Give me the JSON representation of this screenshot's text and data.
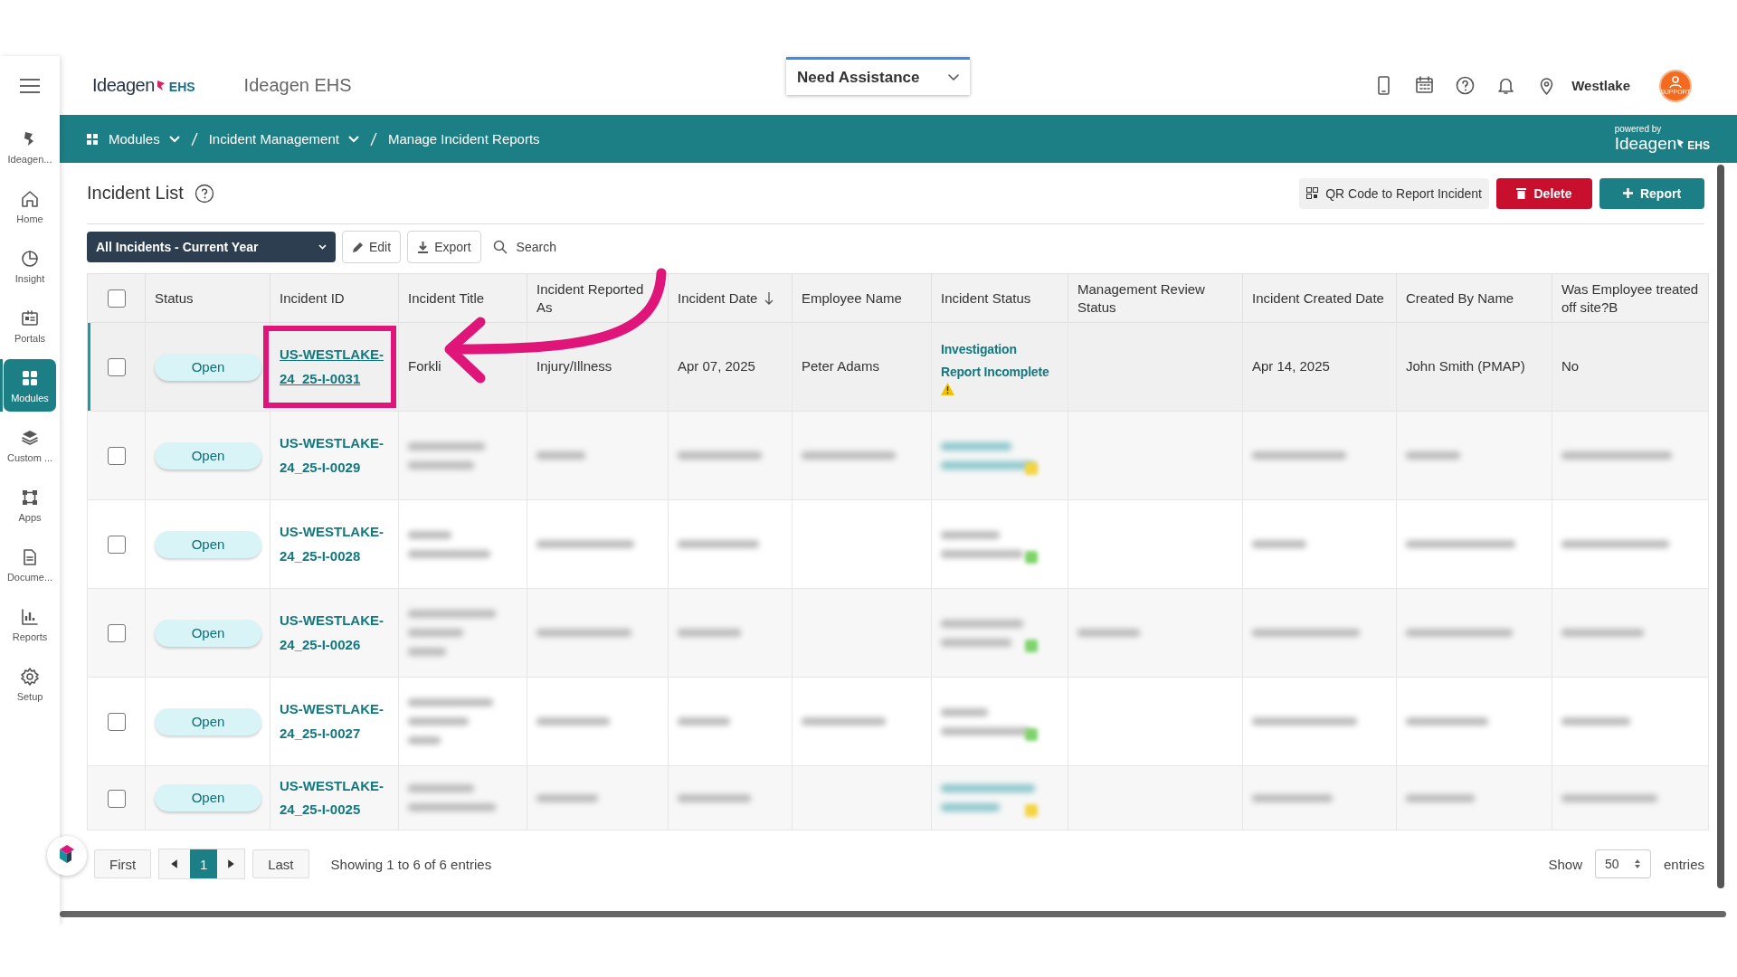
{
  "header": {
    "logo_text": "Ideagen",
    "logo_suffix": "EHS",
    "app_title": "Ideagen EHS",
    "assist": "Need Assistance",
    "location": "Westlake",
    "avatar_text": "SUPPORT"
  },
  "sidebar": {
    "items": [
      {
        "label": "Ideagen...",
        "selected": false
      },
      {
        "label": "Home",
        "selected": false
      },
      {
        "label": "Insight",
        "selected": false
      },
      {
        "label": "Portals",
        "selected": false
      },
      {
        "label": "Modules",
        "selected": true
      },
      {
        "label": "Custom ...",
        "selected": false
      },
      {
        "label": "Apps",
        "selected": false
      },
      {
        "label": "Docume...",
        "selected": false
      },
      {
        "label": "Reports",
        "selected": false
      },
      {
        "label": "Setup",
        "selected": false
      }
    ]
  },
  "breadcrumb": [
    {
      "label": "Modules",
      "dropdown": true
    },
    {
      "label": "Incident Management",
      "dropdown": true
    },
    {
      "label": "Manage Incident Reports",
      "dropdown": false
    }
  ],
  "powered_by": {
    "caption": "powered by",
    "brand": "Ideagen",
    "suffix": "EHS"
  },
  "page_title": "Incident List",
  "actions": [
    {
      "label": "QR Code to Report Incident",
      "kind": "qr"
    },
    {
      "label": "Delete",
      "kind": "delete"
    },
    {
      "label": "Report",
      "kind": "report"
    }
  ],
  "toolbar": {
    "filter": "All Incidents - Current Year",
    "buttons": [
      {
        "label": "Edit",
        "kind": "edit"
      },
      {
        "label": "Export",
        "kind": "export"
      }
    ],
    "search": {
      "placeholder": "Search"
    }
  },
  "table": {
    "select_all_checked": false,
    "columns": [
      {
        "label": "Status",
        "sorted": false
      },
      {
        "label": "Incident ID",
        "sorted": false
      },
      {
        "label": "Incident Title",
        "sorted": false
      },
      {
        "label": "Incident Reported As",
        "sorted": false
      },
      {
        "label": "Incident Date",
        "sorted": true
      },
      {
        "label": "Employee Name",
        "sorted": false
      },
      {
        "label": "Incident Status",
        "sorted": false
      },
      {
        "label": "Management Review Status",
        "sorted": false
      },
      {
        "label": "Incident Created Date",
        "sorted": false
      },
      {
        "label": "Created By Name",
        "sorted": false
      },
      {
        "label": "Was Employee treated off site?B",
        "sorted": false
      }
    ],
    "rows": [
      {
        "selected": true,
        "checked": false,
        "cells": [
          {
            "kind": "badge",
            "text": "Open"
          },
          {
            "kind": "link",
            "text": "US-WESTLAKE-24_25-I-0031",
            "underlined": true,
            "highlighted": true
          },
          {
            "kind": "text",
            "text": "Forkli"
          },
          {
            "kind": "text",
            "text": "Injury/Illness"
          },
          {
            "kind": "text",
            "text": "Apr 07, 2025"
          },
          {
            "kind": "text",
            "text": "Peter Adams"
          },
          {
            "kind": "status",
            "text": "Investigation Report Incomplete",
            "color": "#f2c200"
          },
          {
            "kind": "empty"
          },
          {
            "kind": "text",
            "text": "Apr 14, 2025"
          },
          {
            "kind": "text",
            "text": "John Smith (PMAP)"
          },
          {
            "kind": "text",
            "text": "No"
          }
        ]
      },
      {
        "selected": false,
        "checked": false,
        "cells": [
          {
            "kind": "badge",
            "text": "Open"
          },
          {
            "kind": "link",
            "text": "US-WESTLAKE-24_25-I-0029",
            "underlined": false,
            "highlighted": false
          },
          {
            "kind": "blur2"
          },
          {
            "kind": "blur1"
          },
          {
            "kind": "blur1"
          },
          {
            "kind": "blur1"
          },
          {
            "kind": "blur2",
            "link": true,
            "color": "#f5d442"
          },
          {
            "kind": "empty"
          },
          {
            "kind": "blur1"
          },
          {
            "kind": "blur1"
          },
          {
            "kind": "blur1"
          }
        ]
      },
      {
        "selected": false,
        "checked": false,
        "cells": [
          {
            "kind": "badge",
            "text": "Open"
          },
          {
            "kind": "link",
            "text": "US-WESTLAKE-24_25-I-0028",
            "underlined": false,
            "highlighted": false
          },
          {
            "kind": "blur2"
          },
          {
            "kind": "blur1"
          },
          {
            "kind": "blur1"
          },
          {
            "kind": "empty"
          },
          {
            "kind": "blur2",
            "link": false,
            "color": "#7ed36b"
          },
          {
            "kind": "empty"
          },
          {
            "kind": "blur1"
          },
          {
            "kind": "blur1"
          },
          {
            "kind": "blur1"
          }
        ]
      },
      {
        "selected": false,
        "checked": false,
        "cells": [
          {
            "kind": "badge",
            "text": "Open"
          },
          {
            "kind": "link",
            "text": "US-WESTLAKE-24_25-I-0026",
            "underlined": false,
            "highlighted": false
          },
          {
            "kind": "blur3"
          },
          {
            "kind": "blur1"
          },
          {
            "kind": "blur1"
          },
          {
            "kind": "empty"
          },
          {
            "kind": "blur2",
            "link": false,
            "color": "#7ed36b"
          },
          {
            "kind": "blur1"
          },
          {
            "kind": "blur1"
          },
          {
            "kind": "blur1"
          },
          {
            "kind": "blur1"
          }
        ]
      },
      {
        "selected": false,
        "checked": false,
        "cells": [
          {
            "kind": "badge",
            "text": "Open"
          },
          {
            "kind": "link",
            "text": "US-WESTLAKE-24_25-I-0027",
            "underlined": false,
            "highlighted": false
          },
          {
            "kind": "blur3"
          },
          {
            "kind": "blur1"
          },
          {
            "kind": "blur1"
          },
          {
            "kind": "blur1"
          },
          {
            "kind": "blur2",
            "link": false,
            "color": "#7ed36b"
          },
          {
            "kind": "empty"
          },
          {
            "kind": "blur1"
          },
          {
            "kind": "blur1"
          },
          {
            "kind": "blur1"
          }
        ]
      },
      {
        "selected": false,
        "checked": false,
        "cells": [
          {
            "kind": "badge",
            "text": "Open"
          },
          {
            "kind": "link",
            "text": "US-WESTLAKE-24_25-I-0025",
            "underlined": false,
            "highlighted": false
          },
          {
            "kind": "blur2"
          },
          {
            "kind": "blur1"
          },
          {
            "kind": "blur1"
          },
          {
            "kind": "empty"
          },
          {
            "kind": "blur2",
            "link": true,
            "color": "#f5d442"
          },
          {
            "kind": "empty"
          },
          {
            "kind": "blur1"
          },
          {
            "kind": "blur1"
          },
          {
            "kind": "blur1"
          }
        ]
      }
    ]
  },
  "pagination": {
    "first": "First",
    "pages": [
      {
        "label": "1",
        "selected": true
      }
    ],
    "last": "Last",
    "summary": "Showing 1 to 6 of 6 entries",
    "show": "Show",
    "page_size": "50",
    "entries": "entries"
  },
  "callout": {
    "kind": "arrow"
  }
}
